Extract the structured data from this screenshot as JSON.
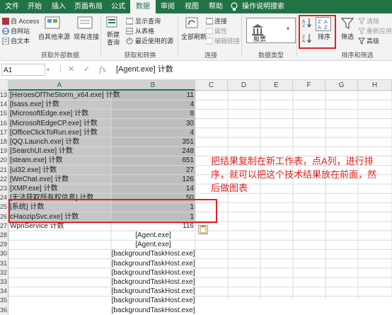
{
  "ribbon_tabs": [
    "文件",
    "开始",
    "插入",
    "页面布局",
    "公式",
    "数据",
    "审阅",
    "视图",
    "帮助"
  ],
  "tell_me": "操作说明搜索",
  "ribbon": {
    "get_external": {
      "items": [
        "自 Access",
        "自网站",
        "自文本"
      ],
      "other_sources": "自其他来源",
      "existing": "现有连接",
      "label": "获取外部数据"
    },
    "get_transform": {
      "new_query": "新建\n查询",
      "items": [
        "显示查询",
        "从表格",
        "最近使用的源"
      ],
      "label": "获取和转换"
    },
    "connections": {
      "refresh_all": "全部刷新",
      "items": [
        "连接",
        "属性",
        "编辑链接"
      ],
      "label": "连接"
    },
    "data_types": {
      "stocks": "股票",
      "label": "数据类型"
    },
    "sort_filter": {
      "sort": "排序",
      "filter": "筛选",
      "clear": "清除",
      "reapply": "重新应用",
      "advanced": "高级",
      "label": "排序和筛选"
    }
  },
  "formula_bar": {
    "name_box": "A1",
    "formula": "[Agent.exe] 计数"
  },
  "columns": [
    "A",
    "B",
    "C",
    "D",
    "E",
    "F",
    "G",
    "H"
  ],
  "rows": [
    {
      "num": "13",
      "a": "[HeroesOfTheStorm_x64.exe] 计数",
      "b": "11"
    },
    {
      "num": "14",
      "a": "[lsass.exe] 计数",
      "b": "4"
    },
    {
      "num": "15",
      "a": "[MicrosoftEdge.exe] 计数",
      "b": "8"
    },
    {
      "num": "16",
      "a": "[MicrosoftEdgeCP.exe] 计数",
      "b": "30"
    },
    {
      "num": "17",
      "a": "[OfficeClickToRun.exe] 计数",
      "b": "4"
    },
    {
      "num": "18",
      "a": "[QQ.Launch.exe] 计数",
      "b": "351"
    },
    {
      "num": "19",
      "a": "[SearchUI.exe] 计数",
      "b": "248"
    },
    {
      "num": "20",
      "a": "[steam.exe] 计数",
      "b": "651"
    },
    {
      "num": "21",
      "a": "[ui32.exe] 计数",
      "b": "27"
    },
    {
      "num": "22",
      "a": "[WeChat.exe] 计数",
      "b": "126"
    },
    {
      "num": "23",
      "a": "[XMP.exe] 计数",
      "b": "14"
    },
    {
      "num": "24",
      "a": "[无法获取所有权信息] 计数",
      "b": "50"
    },
    {
      "num": "25",
      "a": "[系统] 计数",
      "b": "1"
    },
    {
      "num": "26",
      "a": "cHaozipSvc.exe] 计数",
      "b": "1"
    },
    {
      "num": "27",
      "a": "WpnService 计数",
      "b": "116"
    },
    {
      "num": "28",
      "a": "",
      "b": "[Agent.exe]"
    },
    {
      "num": "29",
      "a": "",
      "b": "[Agent.exe]"
    },
    {
      "num": "30",
      "a": "",
      "b": "[backgroundTaskHost.exe]"
    },
    {
      "num": "31",
      "a": "",
      "b": "[backgroundTaskHost.exe]"
    },
    {
      "num": "32",
      "a": "",
      "b": "[backgroundTaskHost.exe]"
    },
    {
      "num": "33",
      "a": "",
      "b": "[backgroundTaskHost.exe]"
    },
    {
      "num": "34",
      "a": "",
      "b": "[backgroundTaskHost.exe]"
    },
    {
      "num": "35",
      "a": "",
      "b": "[backgroundTaskHost.exe]"
    },
    {
      "num": "36",
      "a": "",
      "b": "[backgroundTaskHost.exe]"
    }
  ],
  "annotation": [
    "把结果复制在新工作表，点A列，进行排",
    "序，就可以把这个技术结果放在前面，然",
    "后做图表"
  ],
  "colors": {
    "excel_green": "#217346",
    "annotation_red": "#e02020",
    "selection_gray": "#c6c6c6"
  }
}
